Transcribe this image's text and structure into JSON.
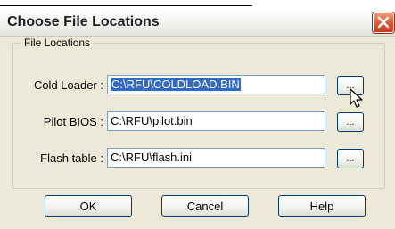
{
  "window": {
    "title": "Choose File Locations"
  },
  "group": {
    "legend": "File Locations"
  },
  "fields": [
    {
      "label": "Cold Loader :",
      "value": "C:\\RFU\\COLDLOAD.BIN",
      "selected": true,
      "browse_label": "..."
    },
    {
      "label": "Pilot BIOS :",
      "value": "C:\\RFU\\pilot.bin",
      "selected": false,
      "browse_label": "..."
    },
    {
      "label": "Flash table :",
      "value": "C:\\RFU\\flash.ini",
      "selected": false,
      "browse_label": "..."
    }
  ],
  "buttons": {
    "ok": "OK",
    "cancel": "Cancel",
    "help": "Help"
  },
  "colors": {
    "selection": "#316ac5",
    "close_button": "#e05a35",
    "dialog_background": "#ece9d8"
  }
}
